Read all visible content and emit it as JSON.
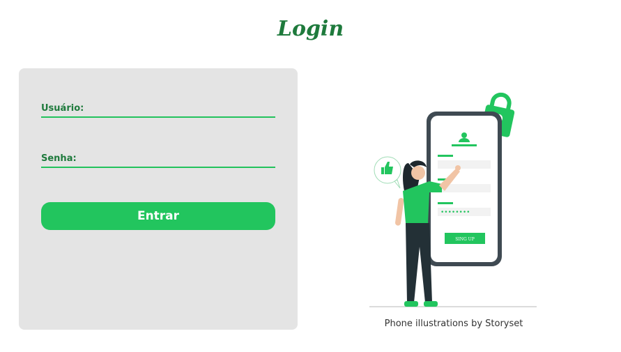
{
  "header": {
    "title": "Login"
  },
  "form": {
    "username_label": "Usuário:",
    "password_label": "Senha:",
    "submit_label": "Entrar"
  },
  "illustration": {
    "button_text": "SING UP",
    "credit": "Phone illustrations by Storyset"
  },
  "colors": {
    "accent": "#22c55e",
    "dark_green": "#1e7a3c",
    "card_bg": "#e4e4e4"
  }
}
